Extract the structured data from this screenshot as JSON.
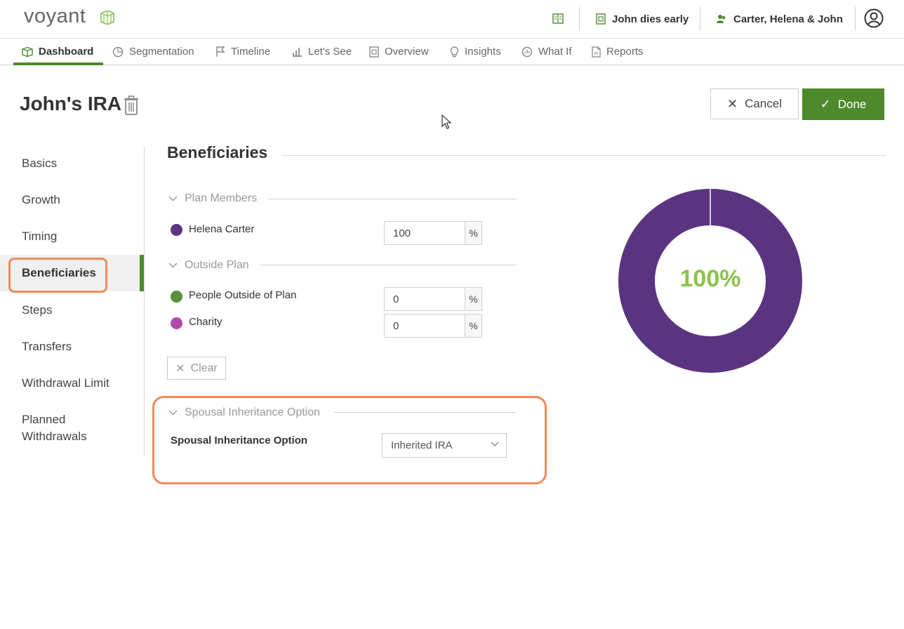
{
  "app": {
    "logo_text": "voyant"
  },
  "header": {
    "scenario_label": "John dies early",
    "client_label": "Carter, Helena & John"
  },
  "nav": {
    "tabs": [
      {
        "label": "Dashboard"
      },
      {
        "label": "Segmentation"
      },
      {
        "label": "Timeline"
      },
      {
        "label": "Let's See"
      },
      {
        "label": "Overview"
      },
      {
        "label": "Insights"
      },
      {
        "label": "What If"
      },
      {
        "label": "Reports"
      }
    ],
    "active_tab": "Dashboard"
  },
  "page": {
    "title": "John's IRA",
    "cancel_label": "Cancel",
    "done_label": "Done"
  },
  "sidebar": {
    "items": [
      {
        "label": "Basics"
      },
      {
        "label": "Growth"
      },
      {
        "label": "Timing"
      },
      {
        "label": "Beneficiaries"
      },
      {
        "label": "Steps"
      },
      {
        "label": "Transfers"
      },
      {
        "label": "Withdrawal Limit"
      },
      {
        "label": "Planned Withdrawals"
      }
    ],
    "active_item": "Beneficiaries"
  },
  "beneficiaries": {
    "title": "Beneficiaries",
    "plan_members": {
      "heading": "Plan Members",
      "rows": [
        {
          "label": "Helena Carter",
          "value": "100",
          "unit": "%",
          "color": "#5b3480"
        }
      ]
    },
    "outside_plan": {
      "heading": "Outside Plan",
      "rows": [
        {
          "label": "People Outside of Plan",
          "value": "0",
          "unit": "%",
          "color": "#5a8f3c"
        },
        {
          "label": "Charity",
          "value": "0",
          "unit": "%",
          "color": "#b04ba8"
        }
      ]
    },
    "clear_label": "Clear",
    "spousal": {
      "heading": "Spousal Inheritance Option",
      "field_label": "Spousal Inheritance Option",
      "selected": "Inherited IRA"
    }
  },
  "chart_data": {
    "type": "pie",
    "categories": [
      "Helena Carter",
      "People Outside of Plan",
      "Charity"
    ],
    "values": [
      100,
      0,
      0
    ],
    "center_label": "100%",
    "colors": [
      "#5b3480",
      "#5a8f3c",
      "#b04ba8"
    ]
  },
  "colors": {
    "accent": "#4e8a2b",
    "highlight": "#f08a5d",
    "center_label": "#8cc24a"
  }
}
